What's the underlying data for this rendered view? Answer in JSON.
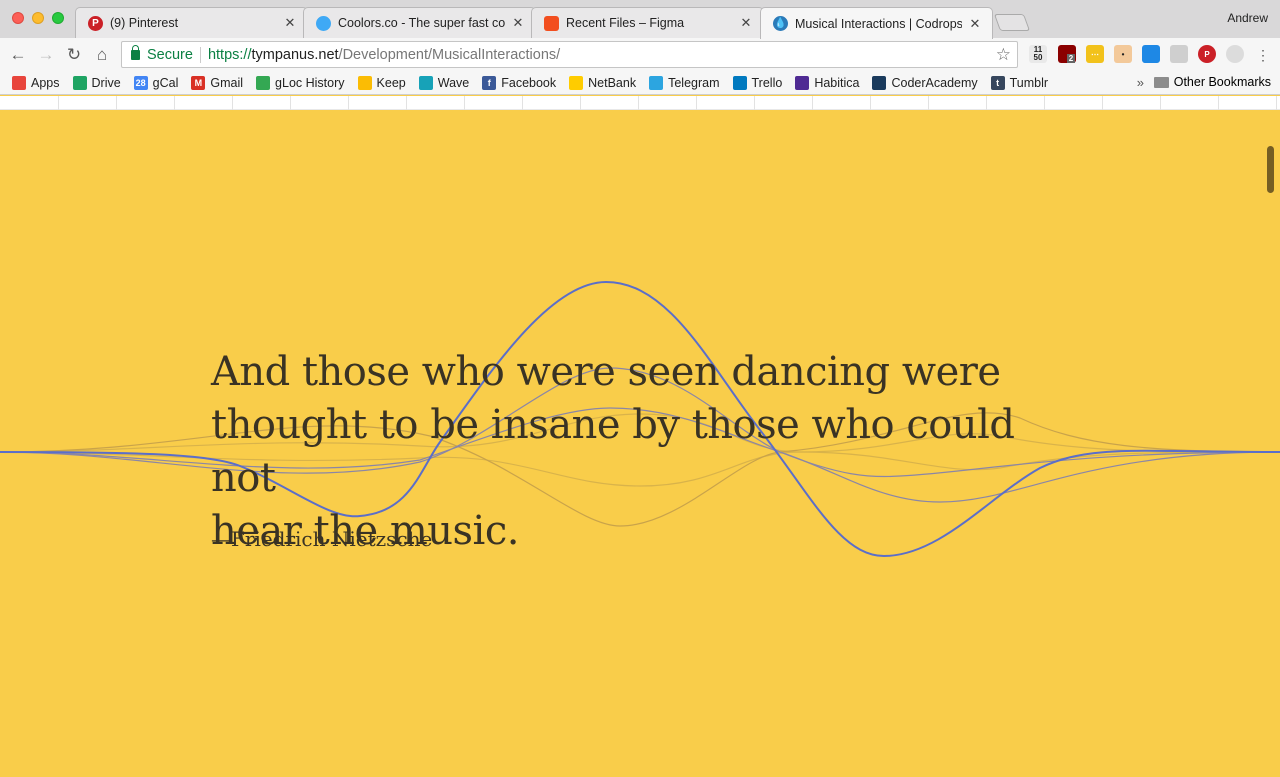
{
  "window": {
    "profile_name": "Andrew"
  },
  "tabs": [
    {
      "label": "(9) Pinterest",
      "icon": "pinterest-icon",
      "color": "#cb2027"
    },
    {
      "label": "Coolors.co - The super fast color schemes generator!",
      "icon": "coolors-icon",
      "color": "#3fa9f5"
    },
    {
      "label": "Recent Files – Figma",
      "icon": "figma-icon",
      "color": "#f24e1e"
    },
    {
      "label": "Musical Interactions | Codrops",
      "icon": "codrops-icon",
      "color": "#2b7bb9"
    }
  ],
  "toolbar": {
    "secure_label": "Secure",
    "url_protocol": "https://",
    "url_host": "tympanus.net",
    "url_path": "/Development/MusicalInteractions/"
  },
  "bookmarks": [
    {
      "label": "Apps",
      "icon": "apps-grid-icon",
      "color": "#e8453c"
    },
    {
      "label": "Drive",
      "icon": "google-drive-icon",
      "color": "#1fa463"
    },
    {
      "label": "gCal",
      "icon": "google-calendar-icon",
      "color": "#4285f4",
      "glyph": "28"
    },
    {
      "label": "Gmail",
      "icon": "gmail-icon",
      "color": "#d93025",
      "glyph": "M"
    },
    {
      "label": "gLoc History",
      "icon": "google-maps-icon",
      "color": "#34a853"
    },
    {
      "label": "Keep",
      "icon": "google-keep-icon",
      "color": "#fbbc04"
    },
    {
      "label": "Wave",
      "icon": "wave-icon",
      "color": "#17a2b8"
    },
    {
      "label": "Facebook",
      "icon": "facebook-icon",
      "color": "#3b5998",
      "glyph": "f"
    },
    {
      "label": "NetBank",
      "icon": "netbank-icon",
      "color": "#ffcc00"
    },
    {
      "label": "Telegram",
      "icon": "telegram-icon",
      "color": "#2ca5e0"
    },
    {
      "label": "Trello",
      "icon": "trello-icon",
      "color": "#0079bf"
    },
    {
      "label": "Habitica",
      "icon": "habitica-icon",
      "color": "#4f2a93"
    },
    {
      "label": "CoderAcademy",
      "icon": "coderacademy-icon",
      "color": "#1a3a5c"
    },
    {
      "label": "Tumblr",
      "icon": "tumblr-icon",
      "color": "#36465d",
      "glyph": "t"
    }
  ],
  "other_bookmarks_label": "Other Bookmarks",
  "more_bookmarks": "»",
  "extension_badge": {
    "date_top": "11",
    "date_bottom": "50",
    "ublock_count": "2"
  },
  "page": {
    "background": "#f9cd4a",
    "wave_color": "#5b6ec9",
    "quote_lines": [
      "And those who were seen dancing were",
      "thought to be insane by those who could not",
      "hear the music."
    ],
    "author": "—Friedrich Nietzsche"
  }
}
